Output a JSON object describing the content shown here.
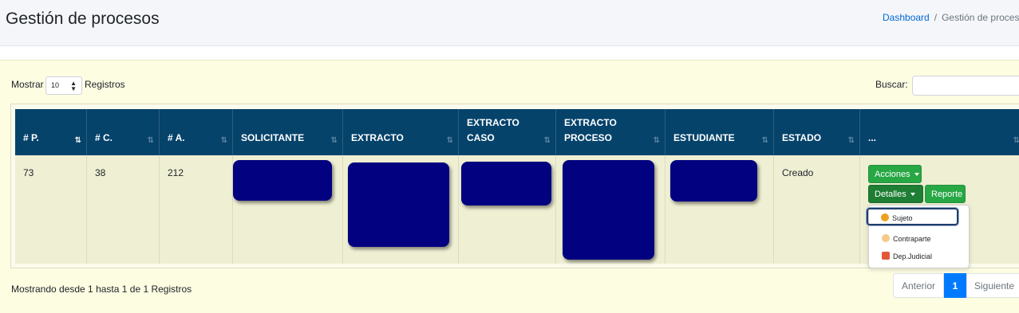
{
  "header": {
    "title": "Gestión de procesos",
    "breadcrumb": [
      "Dashboard",
      "Gestión de proces"
    ]
  },
  "controls": {
    "show_label": "Mostrar",
    "length_value": "10",
    "records_label": "Registros",
    "search_label": "Buscar:",
    "search_value": ""
  },
  "table": {
    "columns": [
      "# P.",
      "# C.",
      "# A.",
      "SOLICITANTE",
      "EXTRACTO",
      "EXTRACTO CASO",
      "EXTRACTO PROCESO",
      "ESTUDIANTE",
      "ESTADO",
      "..."
    ],
    "row": {
      "p": "73",
      "c": "38",
      "a": "212",
      "estado": "Creado"
    },
    "redacted_cells": [
      "SOLICITANTE",
      "EXTRACTO",
      "EXTRACTO CASO",
      "EXTRACTO PROCESO",
      "ESTUDIANTE"
    ]
  },
  "actions": {
    "acciones": "Acciones",
    "detalles": "Detalles",
    "reporte": "Reporte",
    "menu_items": [
      {
        "label": "Sujeto",
        "icon": "person-icon"
      },
      {
        "label": "Contraparte",
        "icon": "people-icon"
      },
      {
        "label": "Dep.Judicial",
        "icon": "building-icon"
      }
    ]
  },
  "footer": {
    "info": "Mostrando desde 1 hasta 1 de 1 Registros",
    "prev": "Anterior",
    "page": "1",
    "next": "Siguiente"
  },
  "colors": {
    "header_bg": "#05436b",
    "redaction": "#020280",
    "success": "#28a745",
    "primary": "#007bff"
  }
}
